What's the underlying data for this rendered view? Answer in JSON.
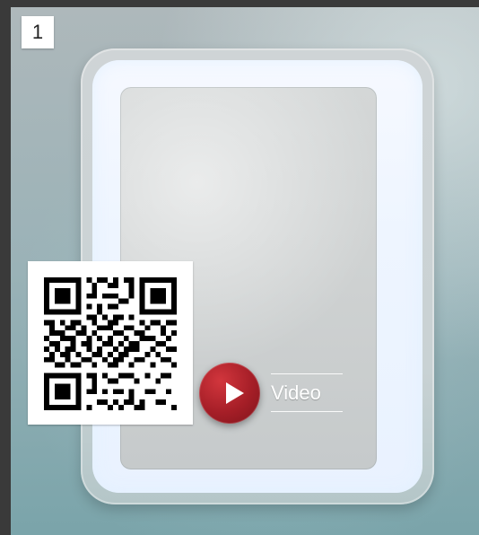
{
  "badge": {
    "number": "1"
  },
  "video": {
    "label": "Video"
  },
  "icons": {
    "play": "play-icon",
    "qr": "qr-code-icon"
  },
  "colors": {
    "play_button": "#a51e27",
    "badge_bg": "#ffffff",
    "wall_teal": "#7aa4aa"
  }
}
